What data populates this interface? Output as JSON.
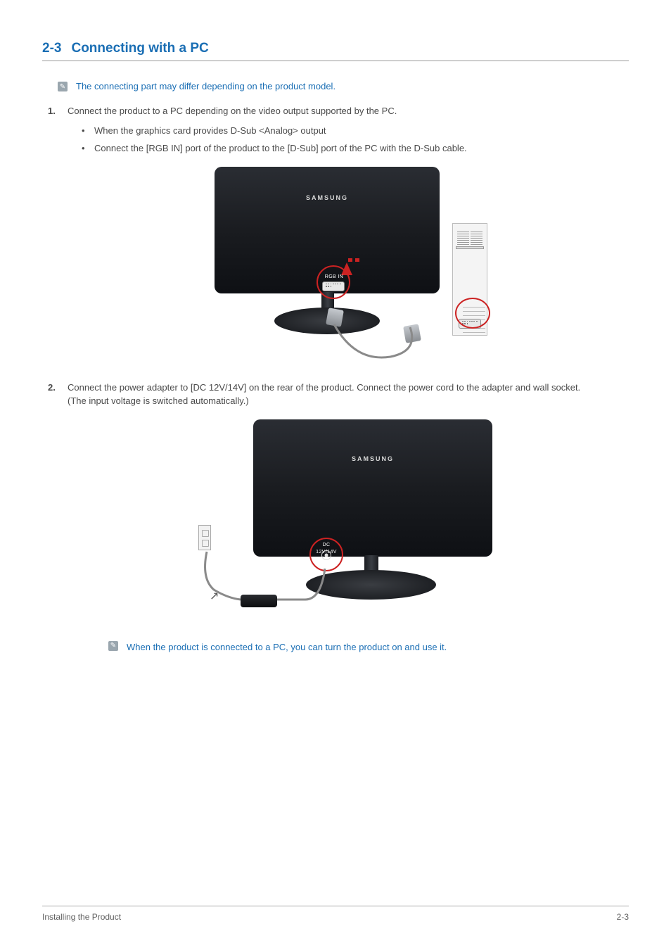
{
  "heading": {
    "num": "2-3",
    "title": "Connecting with a PC"
  },
  "notes": {
    "top": "The connecting part may differ depending on the product model.",
    "bottom": "When the product is connected to a PC, you can turn the product on and use it."
  },
  "steps": {
    "s1": {
      "text": "Connect the product to a PC depending on the video output supported by the PC.",
      "bullets": {
        "b1": "When the graphics card provides D-Sub <Analog> output",
        "b2": "Connect the [RGB IN] port of the product to the [D-Sub] port of the PC with the D-Sub cable."
      }
    },
    "s2": {
      "text": "Connect the power adapter to [DC 12V/14V] on the rear of the product. Connect the power cord to the adapter and wall socket.",
      "text2": "(The input voltage is switched automatically.)"
    }
  },
  "figure": {
    "brand": "SAMSUNG",
    "rgb_label": "RGB IN",
    "dc_label": "DC 12V/14V"
  },
  "footer": {
    "left": "Installing the Product",
    "right": "2-3"
  }
}
